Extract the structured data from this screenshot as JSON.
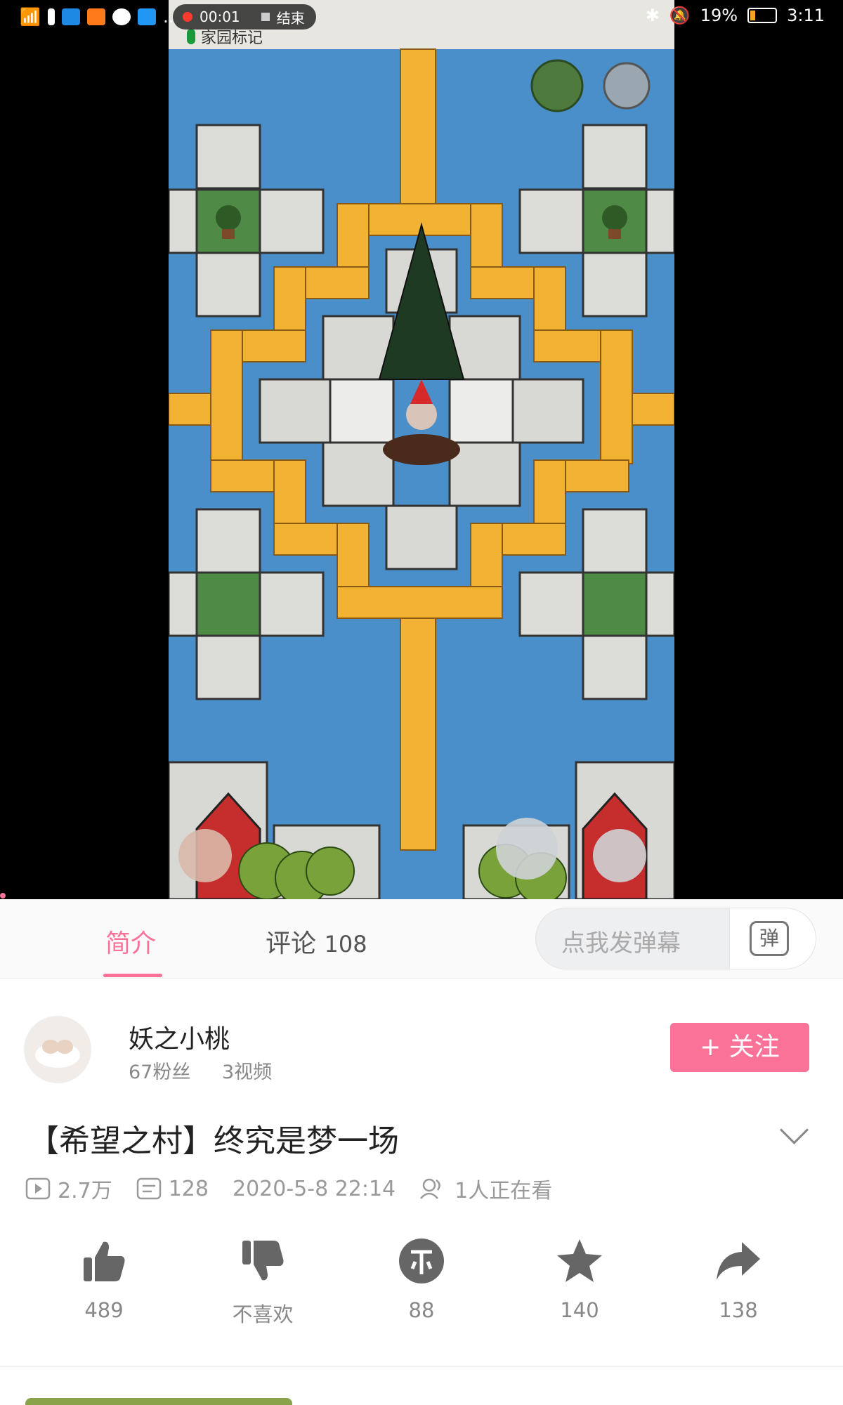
{
  "status_bar": {
    "recording_time": "00:01",
    "recording_stop": "结束",
    "battery": "19%",
    "time": "3:11",
    "dots": "…"
  },
  "game": {
    "home_mark": "家园标记"
  },
  "tabs": {
    "intro": "简介",
    "comments_label": "评论",
    "comments_count": "108"
  },
  "danmaku": {
    "placeholder": "点我发弹幕",
    "icon_char": "弹"
  },
  "uploader": {
    "name": "妖之小桃",
    "fans": "67粉丝",
    "videos": "3视频",
    "follow_label": "关注",
    "follow_plus": "+"
  },
  "video": {
    "title": "【希望之村】终究是梦一场",
    "views": "2.7万",
    "danmaku_count": "128",
    "date": "2020-5-8 22:14",
    "watching": "1人正在看"
  },
  "actions": {
    "like": "489",
    "dislike": "不喜欢",
    "coin": "88",
    "favorite": "140",
    "share": "138"
  },
  "colors": {
    "accent": "#fb7299",
    "water": "#4a8fc9",
    "plank": "#f2b233",
    "stone": "#dcdcd8",
    "grass": "#4f8a46"
  }
}
